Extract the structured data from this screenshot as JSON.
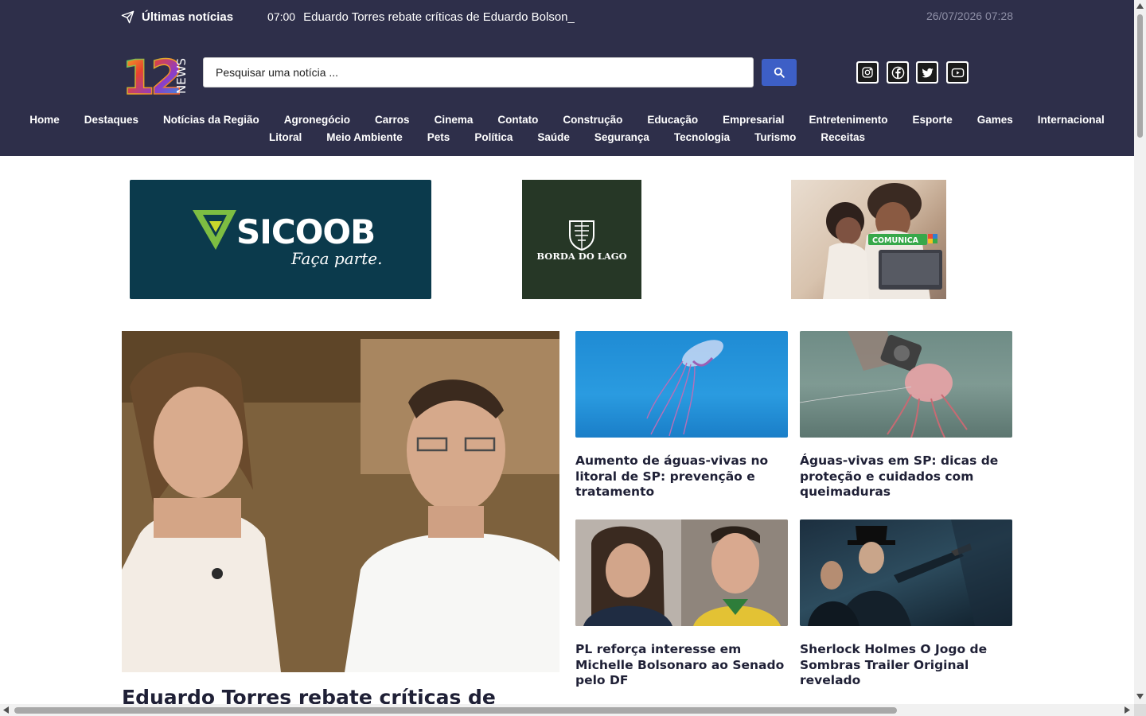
{
  "ticker": {
    "label": "Últimas notícias",
    "time": "07:00",
    "headline": "Eduardo Torres rebate críticas de Eduardo Bolson_",
    "datetime": "26/07/2026 07:28"
  },
  "logo": {
    "number": "12",
    "word": "NEWS"
  },
  "search": {
    "placeholder": "Pesquisar uma notícia ..."
  },
  "social": [
    "instagram-icon",
    "facebook-icon",
    "twitter-icon",
    "youtube-icon"
  ],
  "nav": {
    "row1": [
      "Home",
      "Destaques",
      "Notícias da Região",
      "Agronegócio",
      "Carros",
      "Cinema",
      "Contato",
      "Construção",
      "Educação",
      "Empresarial",
      "Entretenimento",
      "Esporte",
      "Games",
      "Internacional"
    ],
    "row2": [
      "Litoral",
      "Meio Ambiente",
      "Pets",
      "Política",
      "Saúde",
      "Segurança",
      "Tecnologia",
      "Turismo",
      "Receitas"
    ]
  },
  "ads": {
    "sicoob": {
      "brand": "SICOOB",
      "tagline": "Faça parte."
    },
    "borda": {
      "brand": "BORDA DO LAGO"
    },
    "comunica": {
      "brand": "COMUNICA"
    }
  },
  "main_story": {
    "title": "Eduardo Torres rebate críticas de"
  },
  "stories": [
    {
      "title": "Aumento de águas-vivas no litoral de SP: prevenção e tratamento"
    },
    {
      "title": "Águas-vivas em SP: dicas de proteção e cuidados com queimaduras"
    },
    {
      "title": "PL reforça interesse em Michelle Bolsonaro ao Senado pelo DF"
    },
    {
      "title": "Sherlock Holmes O Jogo de Sombras Trailer Original revelado"
    }
  ],
  "colors": {
    "header_bg": "#2e2f4a",
    "search_button": "#3d5fc6",
    "title_text": "#1f2036"
  }
}
